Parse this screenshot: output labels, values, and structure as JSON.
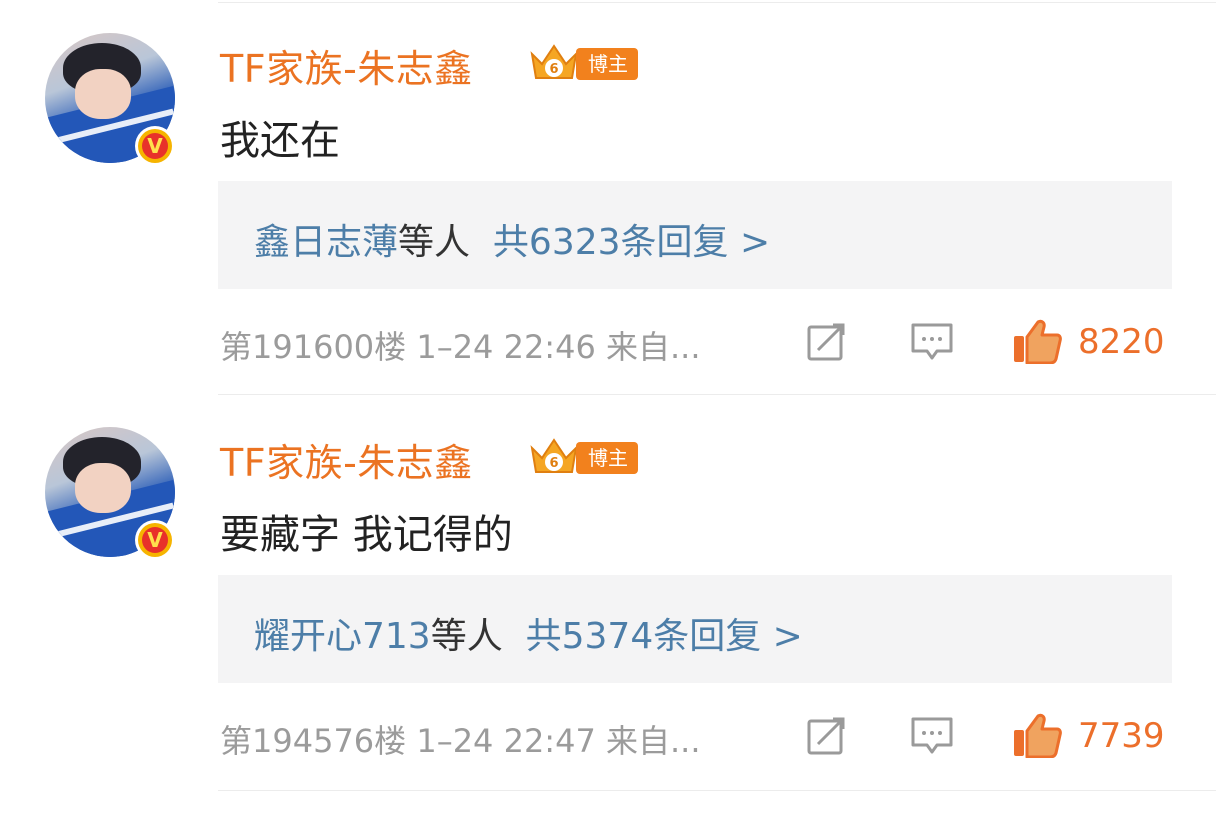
{
  "comments": [
    {
      "username": "TF家族-朱志鑫",
      "badge_label": "博主",
      "badge_level": "6",
      "verified_mark": "V",
      "text": "我还在",
      "reply_users": "鑫日志薄",
      "reply_others": "等人",
      "reply_total": "共6323条回复 >",
      "floor_meta": "第191600楼 1–24 22:46 来自...",
      "like_count": "8220"
    },
    {
      "username": "TF家族-朱志鑫",
      "badge_label": "博主",
      "badge_level": "6",
      "verified_mark": "V",
      "text": "要藏字 我记得的",
      "reply_users": "耀开心713",
      "reply_others": "等人",
      "reply_total": "共5374条回复 >",
      "floor_meta": "第194576楼 1–24 22:47 来自...",
      "like_count": "7739"
    }
  ],
  "colors": {
    "username": "#eb7322",
    "reply_link": "#4d7ea8",
    "like": "#ec6f2b",
    "meta": "#9b9b9b"
  }
}
